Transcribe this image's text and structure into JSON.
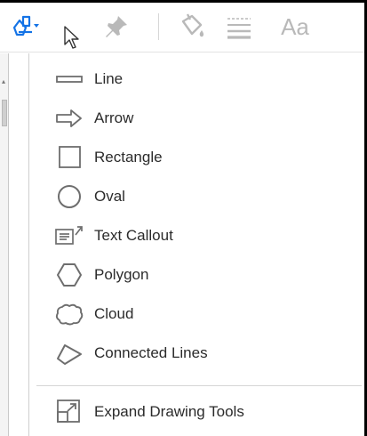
{
  "toolbar": {
    "font_label": "Aa"
  },
  "menu": {
    "items": [
      {
        "label": "Line",
        "icon": "line-icon"
      },
      {
        "label": "Arrow",
        "icon": "arrow-icon"
      },
      {
        "label": "Rectangle",
        "icon": "rectangle-icon"
      },
      {
        "label": "Oval",
        "icon": "oval-icon"
      },
      {
        "label": "Text Callout",
        "icon": "text-callout-icon"
      },
      {
        "label": "Polygon",
        "icon": "polygon-icon"
      },
      {
        "label": "Cloud",
        "icon": "cloud-icon"
      },
      {
        "label": "Connected Lines",
        "icon": "connected-lines-icon"
      }
    ],
    "expand": {
      "label": "Expand Drawing Tools",
      "icon": "expand-icon"
    }
  },
  "colors": {
    "accent": "#1473e6",
    "icon_gray": "#6e6e6e",
    "disabled_gray": "#b9b9b9"
  }
}
